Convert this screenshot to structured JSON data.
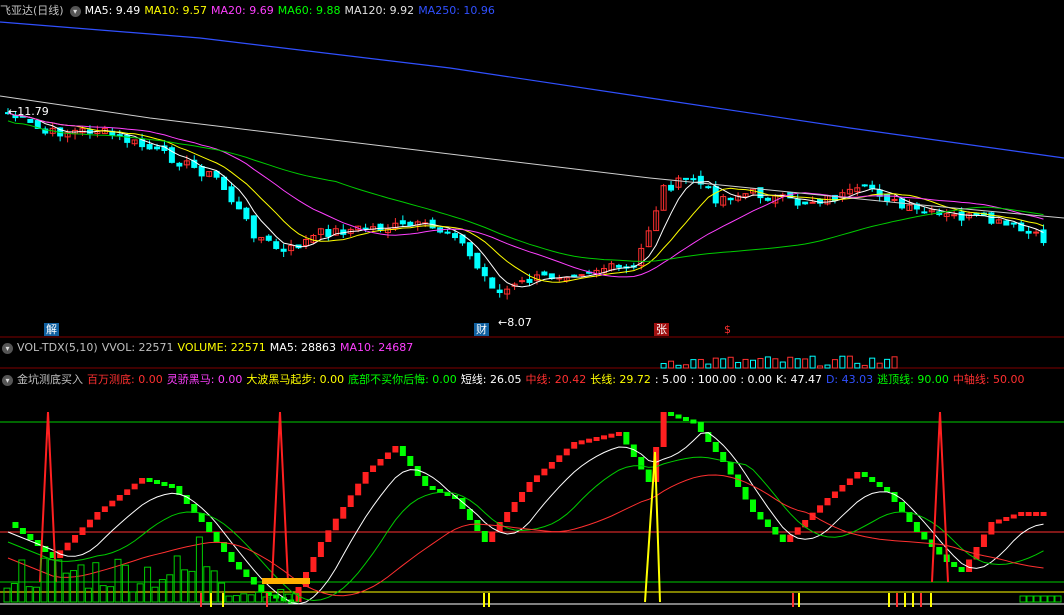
{
  "header": {
    "title": "飞亚达(日线)",
    "ma": [
      {
        "label": "MA5: 9.49",
        "color": "#ffffff"
      },
      {
        "label": "MA10: 9.57",
        "color": "#ffff00"
      },
      {
        "label": "MA20: 9.69",
        "color": "#ff40ff"
      },
      {
        "label": "MA60: 9.88",
        "color": "#00ff00"
      },
      {
        "label": "MA120: 9.92",
        "color": "#e0e0e0"
      },
      {
        "label": "MA250: 10.96",
        "color": "#3050ff"
      }
    ]
  },
  "chart": {
    "high_label": "11.79",
    "low_label": "8.07",
    "markers": [
      {
        "text": "解",
        "color": "#ffffff",
        "bg": "#1060a0"
      },
      {
        "text": "财",
        "color": "#ffffff",
        "bg": "#1060a0"
      },
      {
        "text": "张",
        "color": "#ffffff",
        "bg": "#a01010"
      },
      {
        "text": "$",
        "color": "#ff3030",
        "bg": "transparent"
      }
    ]
  },
  "volume_header": {
    "items": [
      {
        "label": "VOL-TDX(5,10)",
        "color": "#c0c0c0"
      },
      {
        "label": "VVOL: 22571",
        "color": "#c0c0c0"
      },
      {
        "label": "VOLUME: 22571",
        "color": "#ffff00"
      },
      {
        "label": "MA5: 28863",
        "color": "#ffffff"
      },
      {
        "label": "MA10: 24687",
        "color": "#ff40ff"
      }
    ]
  },
  "indicator_header": {
    "items": [
      {
        "label": "金坑测底买入",
        "color": "#c0c0c0"
      },
      {
        "label": "百万测底: 0.00",
        "color": "#ff3030"
      },
      {
        "label": "灵骄黑马: 0.00",
        "color": "#ff40ff"
      },
      {
        "label": "大波黑马起步: 0.00",
        "color": "#ffff00"
      },
      {
        "label": "底部不买你后悔: 0.00",
        "color": "#00ff00"
      },
      {
        "label": "短线: 26.05",
        "color": "#ffffff"
      },
      {
        "label": "中线: 20.42",
        "color": "#ff3030"
      },
      {
        "label": "长线: 29.72",
        "color": "#ffff00"
      },
      {
        "label": ": 5.00",
        "color": "#ffffff"
      },
      {
        "label": ": 100.00",
        "color": "#ffffff"
      },
      {
        "label": ": 0.00",
        "color": "#ffffff"
      },
      {
        "label": "K: 47.47",
        "color": "#ffffff"
      },
      {
        "label": "D: 43.03",
        "color": "#3050ff"
      },
      {
        "label": "逃顶线: 90.00",
        "color": "#00ff00"
      },
      {
        "label": "中轴线: 50.00",
        "color": "#ff3030"
      }
    ]
  },
  "colors": {
    "up": "#ff3030",
    "down": "#00ffff",
    "ind_up": "#ff2020",
    "ind_down": "#00ff00"
  }
}
